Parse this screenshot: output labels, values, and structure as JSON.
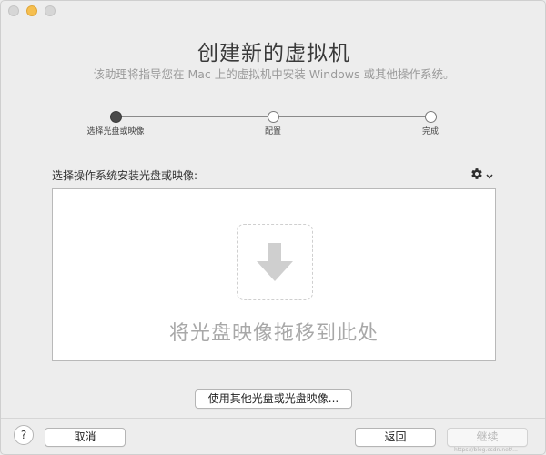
{
  "window": {
    "title": "创建新的虚拟机",
    "subtitle": "该助理将指导您在 Mac 上的虚拟机中安装 Windows 或其他操作系统。"
  },
  "steps": [
    {
      "label": "选择光盘或映像",
      "active": true
    },
    {
      "label": "配置",
      "active": false
    },
    {
      "label": "完成",
      "active": false
    }
  ],
  "section": {
    "label": "选择操作系统安装光盘或映像:",
    "gear_icon": "gear-icon",
    "chevron_icon": "chevron-down-icon"
  },
  "dropzone": {
    "icon": "download-arrow-icon",
    "text": "将光盘映像拖移到此处"
  },
  "buttons": {
    "other": "使用其他光盘或光盘映像...",
    "cancel": "取消",
    "back": "返回",
    "continue": "继续",
    "help": "?"
  },
  "watermark": "https://blog.csdn.net/...",
  "colors": {
    "window_bg": "#ededed",
    "accent_yellow": "#f6bf4f",
    "disabled_text": "#b8b8b8",
    "drop_icon": "#cfcfcf"
  }
}
